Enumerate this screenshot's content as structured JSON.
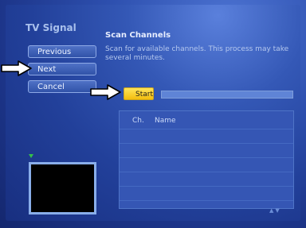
{
  "sidebar": {
    "title": "TV Signal",
    "buttons": [
      {
        "label": "Previous"
      },
      {
        "label": "Next"
      },
      {
        "label": "Cancel"
      }
    ]
  },
  "main": {
    "heading": "Scan Channels",
    "description": "Scan for available channels. This process may take several minutes.",
    "start_label": "Start",
    "progress": 0,
    "channel_list": {
      "columns": [
        "Ch.",
        "Name"
      ]
    }
  },
  "icons": {
    "pointer_next": "hand-pointer-icon",
    "pointer_start": "hand-pointer-icon",
    "scroll": "scroll-arrows-icon",
    "tv_indicator": "green-arrow-icon"
  },
  "colors": {
    "accent_start": "#f3bd0e",
    "background": "#22409a",
    "preview_border": "#89aeea"
  }
}
